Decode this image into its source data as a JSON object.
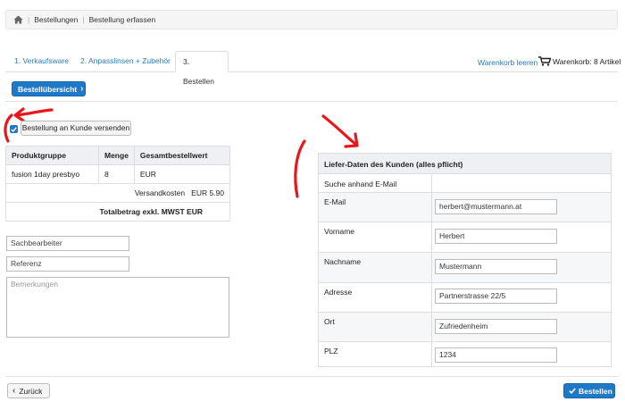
{
  "breadcrumb": {
    "items": [
      "Bestellungen",
      "Bestellung erfassen"
    ]
  },
  "tabs": [
    {
      "label": "1. Verkaufsware"
    },
    {
      "label": "2. Anpasslinsen + Zubehör"
    },
    {
      "label": "3. Bestellen"
    }
  ],
  "cart": {
    "clear_label": "Warenkorb leeren",
    "count_label": "Warenkorb: 8 Artikel"
  },
  "overview_button": "Bestellübersicht",
  "send_checkbox": {
    "label": "Bestellung an Kunde versenden",
    "checked": true
  },
  "order_table": {
    "headers": [
      "Produktgruppe",
      "Menge",
      "Gesamtbestellwert"
    ],
    "row": [
      "fusion 1day presbyo",
      "8",
      "EUR"
    ],
    "shipping": "Versandkosten   EUR 5.90",
    "total": "Totalbetrag exkl. MWST EUR"
  },
  "fields": {
    "clerk_placeholder": "Sachbearbeiter",
    "reference_placeholder": "Referenz",
    "remarks_placeholder": "Bemerkungen"
  },
  "delivery": {
    "title": "Liefer-Daten des Kunden (alles pflicht)",
    "search_label": "Suche anhand E-Mail",
    "rows": [
      {
        "label": "E-Mail",
        "value": "herbert@mustermann.at"
      },
      {
        "label": "Vorname",
        "value": "Herbert"
      },
      {
        "label": "Nachname",
        "value": "Mustermann"
      },
      {
        "label": "Adresse",
        "value": "Partnerstrasse 22/5"
      },
      {
        "label": "Ort",
        "value": "Zufriedenheim"
      },
      {
        "label": "PLZ",
        "value": "1234"
      }
    ]
  },
  "footer": {
    "back_label": "Zurück",
    "order_label": "Bestellen"
  },
  "colors": {
    "primary": "#1f78c8",
    "link": "#2a7ab8",
    "annotation": "#e8171d"
  }
}
